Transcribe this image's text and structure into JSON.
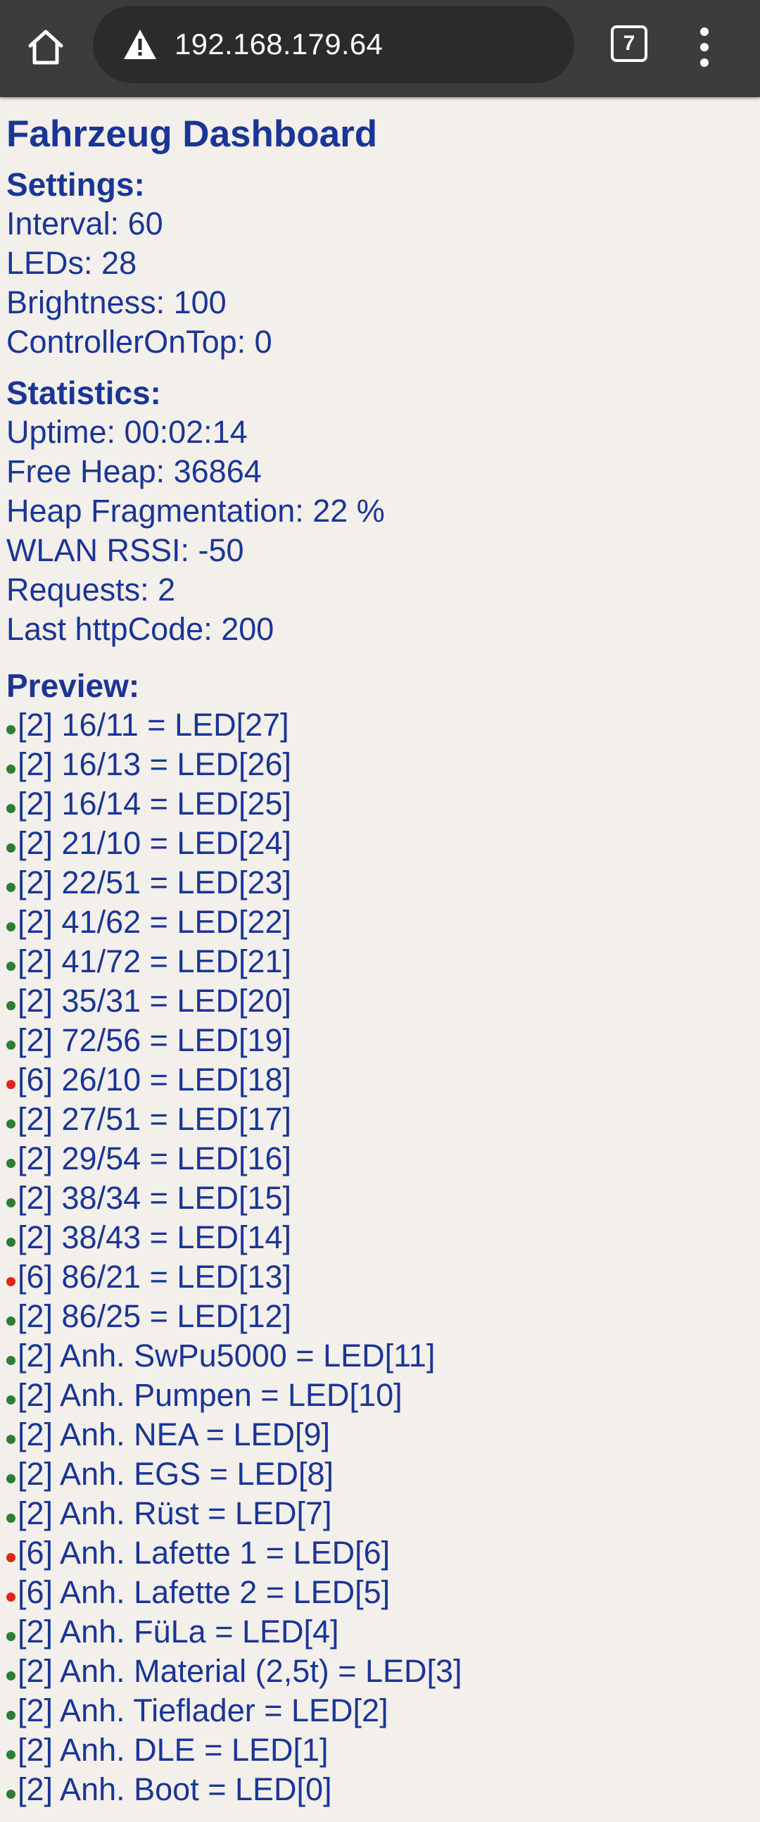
{
  "browser": {
    "url": "192.168.179.64",
    "tab_count": "7"
  },
  "page": {
    "title": "Fahrzeug Dashboard",
    "settings": {
      "heading": "Settings:",
      "lines": [
        "Interval: 60",
        "LEDs: 28",
        "Brightness: 100",
        "ControllerOnTop: 0"
      ]
    },
    "statistics": {
      "heading": "Statistics:",
      "lines": [
        "Uptime: 00:02:14",
        "Free Heap: 36864",
        "Heap Fragmentation: 22 %",
        "WLAN RSSI: -50",
        "Requests: 2",
        "Last httpCode: 200"
      ]
    },
    "preview": {
      "heading": "Preview:",
      "colors": {
        "green": "#2e7d32",
        "red": "#e0241b"
      },
      "items": [
        {
          "status": "green",
          "text": "[2] 16/11 = LED[27]"
        },
        {
          "status": "green",
          "text": "[2] 16/13 = LED[26]"
        },
        {
          "status": "green",
          "text": "[2] 16/14 = LED[25]"
        },
        {
          "status": "green",
          "text": "[2] 21/10 = LED[24]"
        },
        {
          "status": "green",
          "text": "[2] 22/51 = LED[23]"
        },
        {
          "status": "green",
          "text": "[2] 41/62 = LED[22]"
        },
        {
          "status": "green",
          "text": "[2] 41/72 = LED[21]"
        },
        {
          "status": "green",
          "text": "[2] 35/31 = LED[20]"
        },
        {
          "status": "green",
          "text": "[2] 72/56 = LED[19]"
        },
        {
          "status": "red",
          "text": "[6] 26/10 = LED[18]"
        },
        {
          "status": "green",
          "text": "[2] 27/51 = LED[17]"
        },
        {
          "status": "green",
          "text": "[2] 29/54 = LED[16]"
        },
        {
          "status": "green",
          "text": "[2] 38/34 = LED[15]"
        },
        {
          "status": "green",
          "text": "[2] 38/43 = LED[14]"
        },
        {
          "status": "red",
          "text": "[6] 86/21 = LED[13]"
        },
        {
          "status": "green",
          "text": "[2] 86/25 = LED[12]"
        },
        {
          "status": "green",
          "text": "[2] Anh. SwPu5000 = LED[11]"
        },
        {
          "status": "green",
          "text": "[2] Anh. Pumpen = LED[10]"
        },
        {
          "status": "green",
          "text": "[2] Anh. NEA = LED[9]"
        },
        {
          "status": "green",
          "text": "[2] Anh. EGS = LED[8]"
        },
        {
          "status": "green",
          "text": "[2] Anh. Rüst = LED[7]"
        },
        {
          "status": "red",
          "text": "[6] Anh. Lafette 1 = LED[6]"
        },
        {
          "status": "red",
          "text": "[6] Anh. Lafette 2 = LED[5]"
        },
        {
          "status": "green",
          "text": "[2] Anh. FüLa = LED[4]"
        },
        {
          "status": "green",
          "text": "[2] Anh. Material (2,5t) = LED[3]"
        },
        {
          "status": "green",
          "text": "[2] Anh. Tieflader = LED[2]"
        },
        {
          "status": "green",
          "text": "[2] Anh. DLE = LED[1]"
        },
        {
          "status": "green",
          "text": "[2] Anh. Boot = LED[0]"
        }
      ]
    }
  }
}
